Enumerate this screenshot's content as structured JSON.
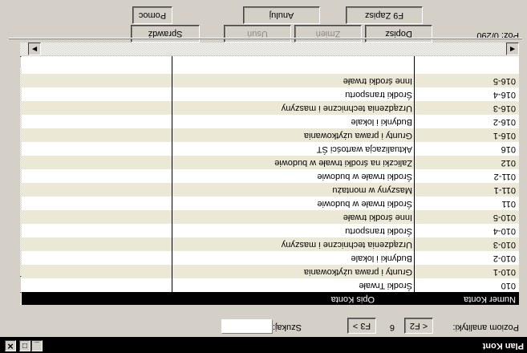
{
  "window": {
    "title": "Plan Kont"
  },
  "analytics": {
    "label": "Poziom analityki:",
    "prev_button": "< F2",
    "level": "6",
    "next_button": "F3 >"
  },
  "search": {
    "label": "Szukaj:",
    "value": ""
  },
  "grid": {
    "columns": [
      "Numer Konta",
      "Opis Konta"
    ],
    "rows": [
      {
        "num": "010",
        "desc": "Środki Trwałe"
      },
      {
        "num": "010-1",
        "desc": "Grunty i prawa użytkowania"
      },
      {
        "num": "010-2",
        "desc": "Budynki i lokale"
      },
      {
        "num": "010-3",
        "desc": "Urządzenia techniczne i maszyny"
      },
      {
        "num": "010-4",
        "desc": "Środki transportu"
      },
      {
        "num": "010-5",
        "desc": "Inne środki trwałe"
      },
      {
        "num": "011",
        "desc": "Środki trwałe w budowie"
      },
      {
        "num": "011-1",
        "desc": "Maszyny w montażu"
      },
      {
        "num": "011-2",
        "desc": "Środki trwałe w budowie"
      },
      {
        "num": "012",
        "desc": "Zaliczki na środki trwałe w budowie"
      },
      {
        "num": "016",
        "desc": "Aktualizacja wartości ŚT"
      },
      {
        "num": "016-1",
        "desc": "Grunty i prawa użytkowania"
      },
      {
        "num": "016-2",
        "desc": "Budynki i lokale"
      },
      {
        "num": "016-3",
        "desc": "Urządzenia techniczne i maszyny"
      },
      {
        "num": "016-4",
        "desc": "Środki transportu"
      },
      {
        "num": "016-5",
        "desc": "Inne środki trwałe"
      }
    ]
  },
  "position": {
    "label": "Poz: 0/290"
  },
  "row_buttons": {
    "copy": "Dopisz",
    "change": "Zmień",
    "delete": "Usuń",
    "check": "Sprawdź"
  },
  "bottom_buttons": {
    "save": "F9 Zapisz",
    "cancel": "Anuluj",
    "help": "Pomoc"
  }
}
